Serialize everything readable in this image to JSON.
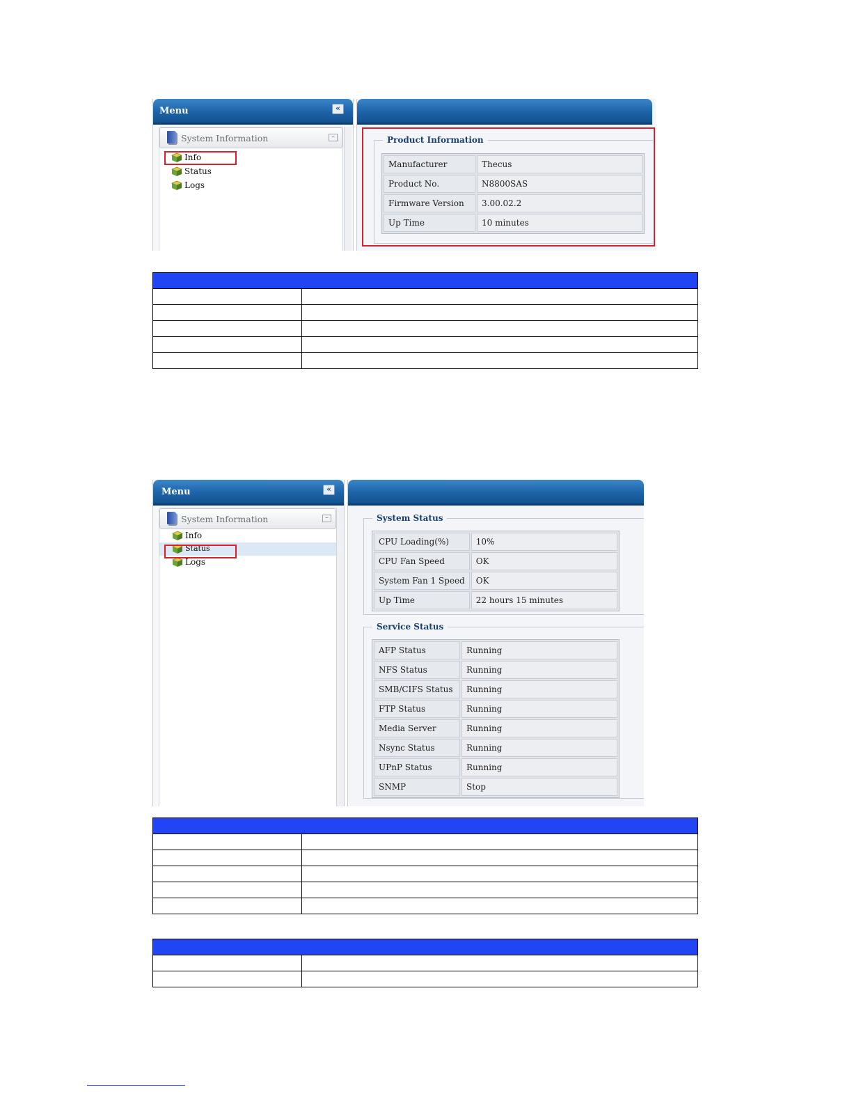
{
  "screenshot1": {
    "menu_title": "Menu",
    "collapse_icon": "double-chevron-left-icon",
    "tree_root": "System Information",
    "tree_items": [
      "Info",
      "Status",
      "Logs"
    ],
    "product_info": {
      "legend": "Product Information",
      "rows": [
        {
          "key": "Manufacturer",
          "value": "Thecus"
        },
        {
          "key": "Product No.",
          "value": "N8800SAS"
        },
        {
          "key": "Firmware Version",
          "value": "3.00.02.2"
        },
        {
          "key": "Up Time",
          "value": "10 minutes"
        }
      ]
    }
  },
  "screenshot2": {
    "menu_title": "Menu",
    "collapse_icon": "double-chevron-left-icon",
    "tree_root": "System Information",
    "tree_items": [
      "Info",
      "Status",
      "Logs"
    ],
    "system_status": {
      "legend": "System Status",
      "rows": [
        {
          "key": "CPU Loading(%)",
          "value": "10%"
        },
        {
          "key": "CPU Fan Speed",
          "value": "OK"
        },
        {
          "key": "System Fan 1 Speed",
          "value": "OK"
        },
        {
          "key": "Up Time",
          "value": "22 hours 15 minutes"
        }
      ]
    },
    "service_status": {
      "legend": "Service Status",
      "rows": [
        {
          "key": "AFP Status",
          "value": "Running",
          "state": "running"
        },
        {
          "key": "NFS Status",
          "value": "Running",
          "state": "running"
        },
        {
          "key": "SMB/CIFS Status",
          "value": "Running",
          "state": "running"
        },
        {
          "key": "FTP Status",
          "value": "Running",
          "state": "running"
        },
        {
          "key": "Media Server",
          "value": "Running",
          "state": "running"
        },
        {
          "key": "Nsync Status",
          "value": "Running",
          "state": "running"
        },
        {
          "key": "UPnP Status",
          "value": "Running",
          "state": "running"
        },
        {
          "key": "SNMP",
          "value": "Stop",
          "state": "stop"
        }
      ]
    }
  },
  "colors": {
    "header_blue": "#1d63a8",
    "table_header_blue": "#2145f5",
    "highlight_red": "#d9202a",
    "running_blue": "#1a34b8",
    "stop_red": "#e02020"
  }
}
